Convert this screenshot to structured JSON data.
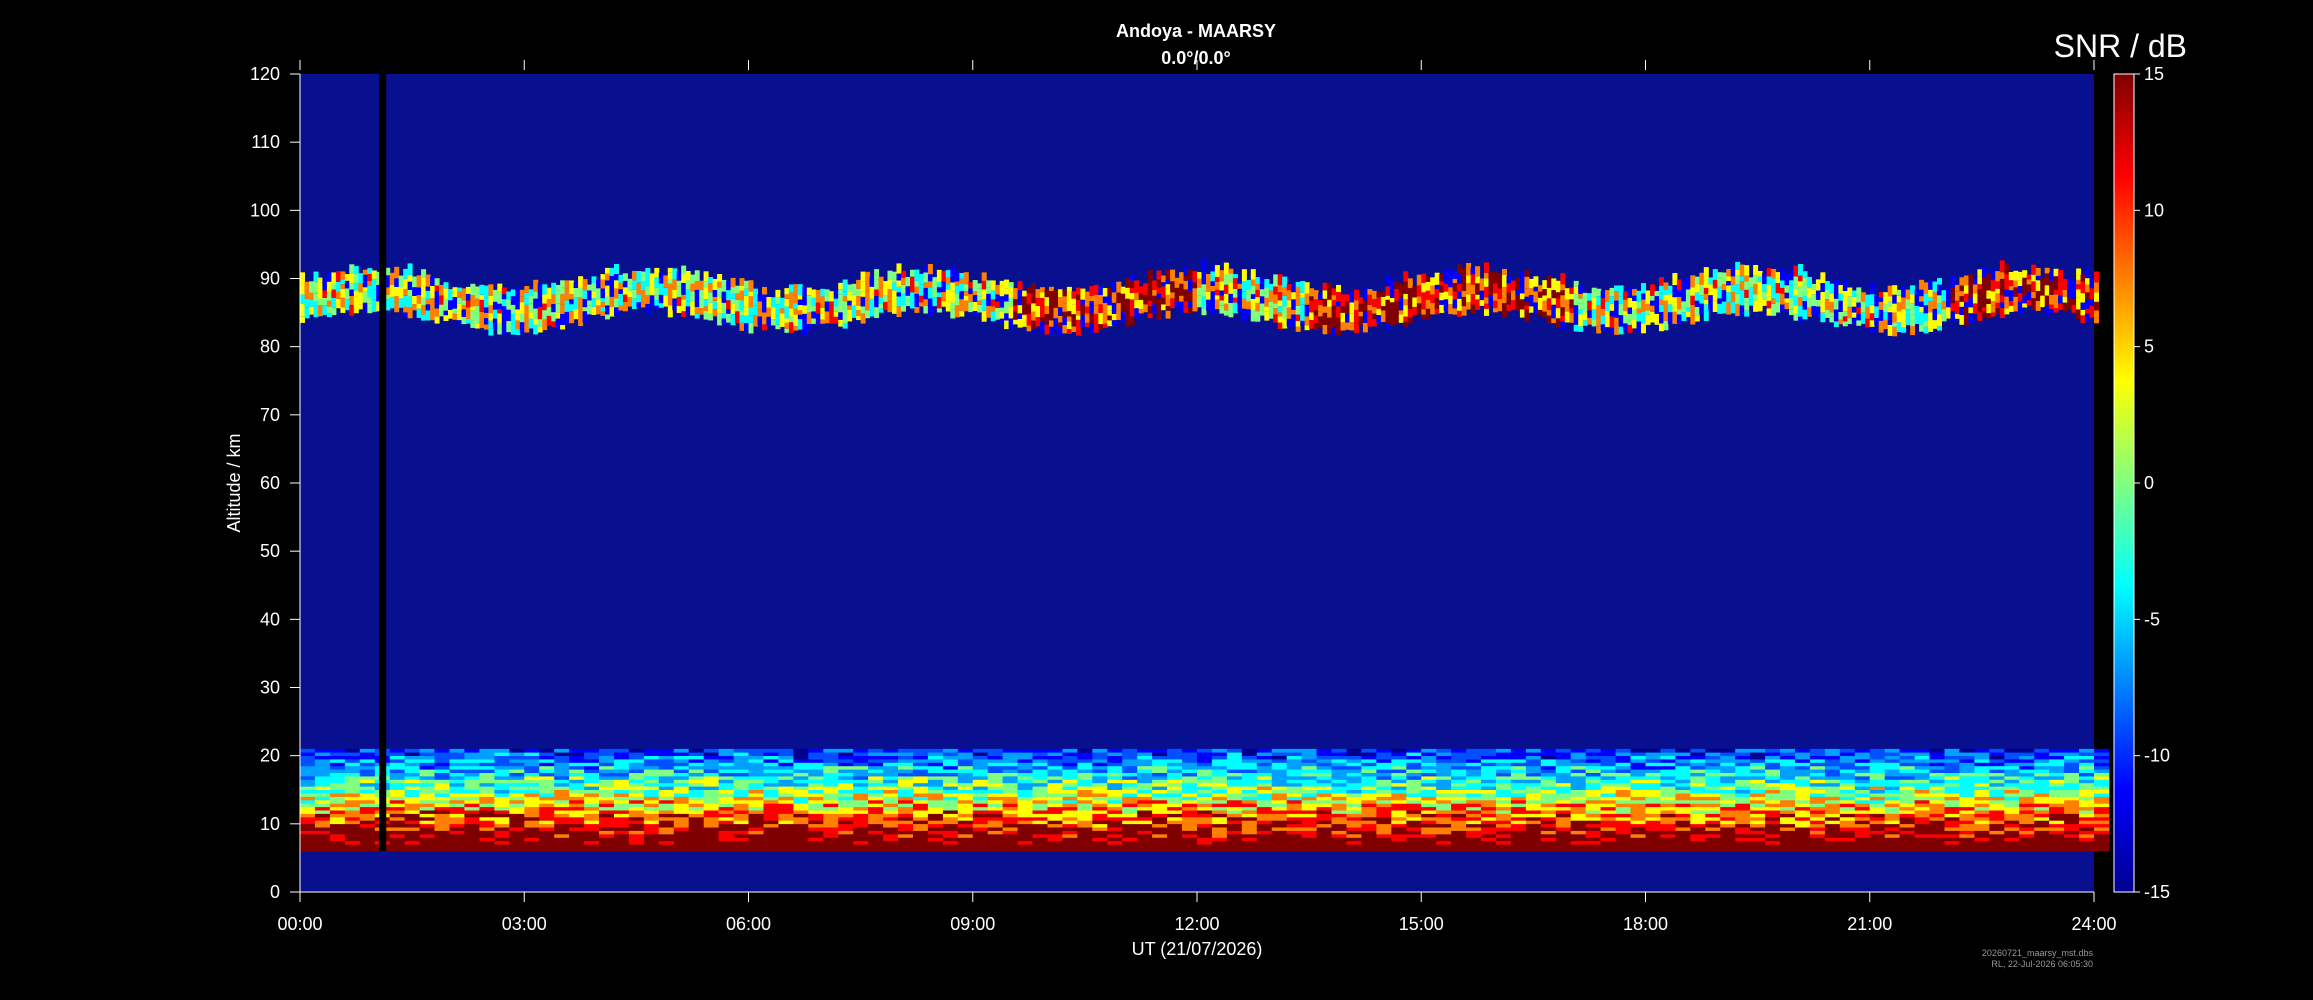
{
  "header": {
    "title": "Andoya - MAARSY",
    "subtitle": "0.0°/0.0°",
    "colorbar_label": "SNR / dB"
  },
  "footer": {
    "file": "20260721_maarsy_mst.dbs",
    "stamp": "RL, 22-Jul-2026 06:05:30"
  },
  "chart_data": {
    "type": "heatmap",
    "title": "Andoya - MAARSY",
    "subtitle": "0.0°/0.0°",
    "xlabel": "UT (21/07/2026)",
    "ylabel": "Altitude / km",
    "x_ticks": [
      "00:00",
      "03:00",
      "06:00",
      "09:00",
      "12:00",
      "15:00",
      "18:00",
      "21:00",
      "24:00"
    ],
    "xlim_hours": [
      0,
      24
    ],
    "y_ticks": [
      0,
      10,
      20,
      30,
      40,
      50,
      60,
      70,
      80,
      90,
      100,
      110,
      120
    ],
    "ylim": [
      0,
      120
    ],
    "colorbar": {
      "label": "SNR / dB",
      "range": [
        -15,
        15
      ],
      "ticks": [
        15,
        10,
        5,
        0,
        -5,
        -10,
        -15
      ],
      "colormap": "jet"
    },
    "data_gap": {
      "ut_hours": 1.1,
      "altitude_km": [
        6,
        120
      ]
    },
    "features": {
      "echo_layer_km": [
        81,
        92
      ],
      "echo_layer_strongest_ut_hours": [
        [
          9.5,
          12.0
        ],
        [
          13.5,
          17.0
        ],
        [
          22.0,
          24.0
        ]
      ],
      "lower_clutter_km": [
        6,
        21
      ]
    },
    "colors": {
      "background": "#000000",
      "axis": "#ffffff",
      "field": "#08108f"
    }
  }
}
